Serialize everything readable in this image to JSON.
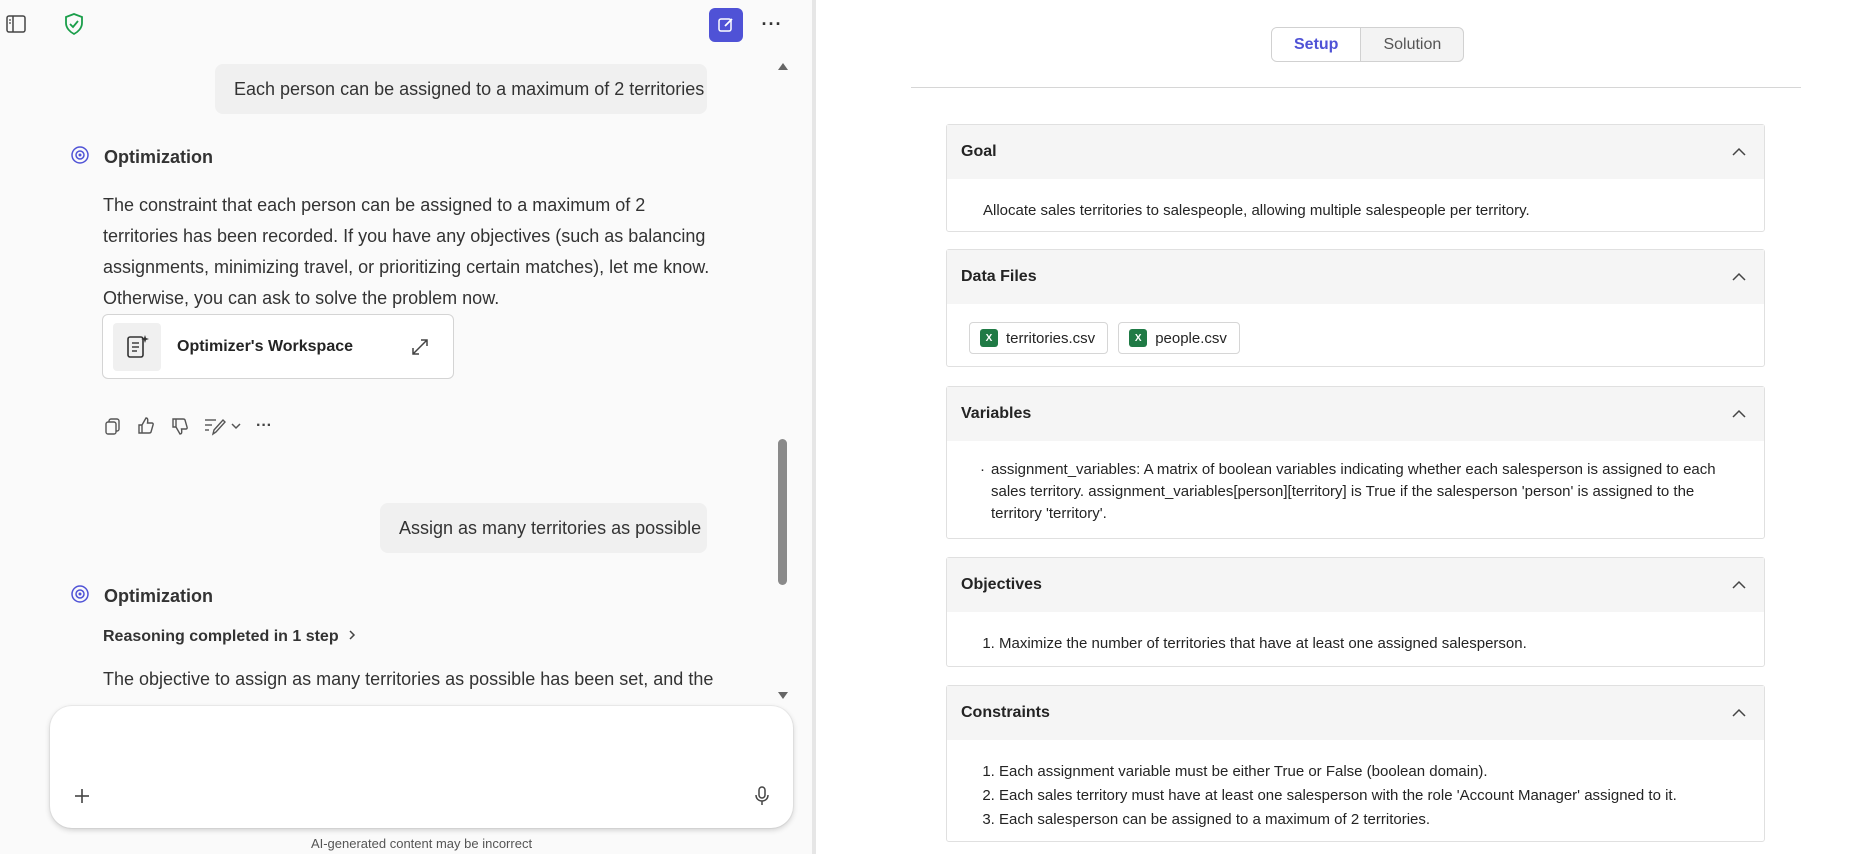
{
  "chat": {
    "user_messages": [
      "Each person can be assigned to a maximum of 2 territories",
      "Assign as many territories as possible"
    ],
    "bot_name": "Optimization",
    "bot_reply_1": "The constraint that each person can be assigned to a maximum of 2 territories has been recorded. If you have any objectives (such as balancing assignments, minimizing travel, or prioritizing certain matches), let me know. Otherwise, you can ask to solve the problem now.",
    "workspace_card": "Optimizer's Workspace",
    "reasoning": "Reasoning completed in 1 step",
    "bot_reply_2": "The objective to assign as many territories as possible has been set, and the",
    "composer_placeholder": "",
    "disclaimer": "AI-generated content may be incorrect"
  },
  "tabs": [
    {
      "label": "Setup",
      "active": true
    },
    {
      "label": "Solution",
      "active": false
    }
  ],
  "sections": {
    "goal": {
      "title": "Goal",
      "text": "Allocate sales territories to salespeople, allowing multiple salespeople per territory."
    },
    "data_files": {
      "title": "Data Files",
      "files": [
        "territories.csv",
        "people.csv"
      ]
    },
    "variables": {
      "title": "Variables",
      "items": [
        "assignment_variables: A matrix of boolean variables indicating whether each salesperson is assigned to each sales territory. assignment_variables[person][territory] is True if the salesperson 'person' is assigned to the territory 'territory'."
      ]
    },
    "objectives": {
      "title": "Objectives",
      "items": [
        "Maximize the number of territories that have at least one assigned salesperson."
      ]
    },
    "constraints": {
      "title": "Constraints",
      "items": [
        "Each assignment variable must be either True or False (boolean domain).",
        "Each sales territory must have at least one salesperson with the role 'Account Manager' assigned to it.",
        "Each salesperson can be assigned to a maximum of 2 territories."
      ]
    }
  },
  "icons": {
    "sidebar": "sidebar-toggle-icon",
    "shield": "shield-check-icon",
    "new_chat": "compose-icon",
    "more": "more-icon",
    "bot": "optimization-bot-icon",
    "card": "document-sparkle-icon",
    "expand": "expand-icon",
    "copy": "copy-icon",
    "like": "thumbs-up-icon",
    "dislike": "thumbs-down-icon",
    "edit": "edit-icon",
    "plus": "plus-icon",
    "mic": "microphone-icon",
    "xl": "excel-file-icon"
  },
  "colors": {
    "accent": "#4f52d6",
    "shield": "#1a9e4a",
    "excel": "#1f7a45"
  },
  "xl_glyph": "X"
}
